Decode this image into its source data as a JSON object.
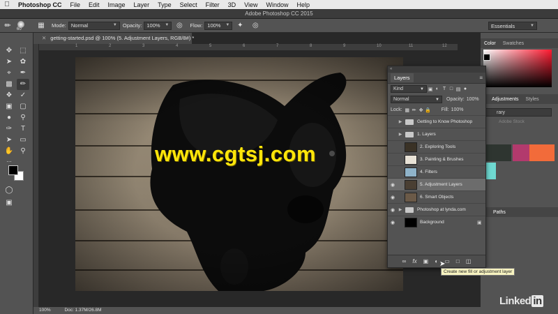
{
  "menubar": {
    "app_name": "Photoshop CC",
    "items": [
      "File",
      "Edit",
      "Image",
      "Layer",
      "Type",
      "Select",
      "Filter",
      "3D",
      "View",
      "Window",
      "Help"
    ]
  },
  "window_title": "Adobe Photoshop CC 2015",
  "options": {
    "brush_size": "60",
    "mode_label": "Mode:",
    "mode_value": "Normal",
    "opacity_label": "Opacity:",
    "opacity_value": "100%",
    "flow_label": "Flow:",
    "flow_value": "100%",
    "workspace": "Essentials"
  },
  "document": {
    "tab_title": "getting-started.psd @ 100% (5. Adjustment Layers, RGB/8#) *",
    "zoom": "100%",
    "doc_size": "Doc: 1.37M/26.8M"
  },
  "ruler": [
    "1",
    "2",
    "3",
    "4",
    "5",
    "6",
    "7",
    "8",
    "9",
    "10",
    "11",
    "12"
  ],
  "watermark": "www.cgtsj.com",
  "layers_panel": {
    "title": "Layers",
    "kind": "Kind",
    "blend_mode": "Normal",
    "opacity_label": "Opacity:",
    "opacity_value": "100%",
    "lock_label": "Lock:",
    "fill_label": "Fill:",
    "fill_value": "100%",
    "layers": [
      {
        "name": "Getting to Know Photoshop",
        "kind": "group",
        "visible": false
      },
      {
        "name": "1. Layers",
        "kind": "group",
        "visible": false
      },
      {
        "name": "2. Exploring Tools",
        "kind": "layer",
        "visible": false,
        "thumb": "#3a3226"
      },
      {
        "name": "3. Painting & Brushes",
        "kind": "layer",
        "visible": false,
        "thumb": "#e8e2d6"
      },
      {
        "name": "4. Filters",
        "kind": "layer",
        "visible": false,
        "thumb": "#8fb3c9"
      },
      {
        "name": "5. Adjustment Layers",
        "kind": "layer",
        "visible": true,
        "selected": true,
        "thumb": "#4a3f33"
      },
      {
        "name": "6. Smart Objects",
        "kind": "layer",
        "visible": true,
        "thumb": "#6b5a48"
      },
      {
        "name": "Photoshop at lynda.com",
        "kind": "group",
        "visible": true
      },
      {
        "name": "Background",
        "kind": "layer",
        "visible": true,
        "locked": true,
        "thumb": "#000000"
      }
    ]
  },
  "tooltip": "Create new fill or adjustment layer",
  "dock": {
    "color_tab": "Color",
    "swatches_tab": "Swatches",
    "adjustments_tab": "Adjustments",
    "styles_tab": "Styles",
    "library_field": "rary",
    "library_stock": "Adobe Stock",
    "paths_tab": "Paths",
    "swatch_colors": [
      "#2e3530",
      "#b23a6d",
      "#f26b3a",
      "#6fd9d1"
    ]
  },
  "linkedin": {
    "word": "Linked",
    "in": "in"
  }
}
